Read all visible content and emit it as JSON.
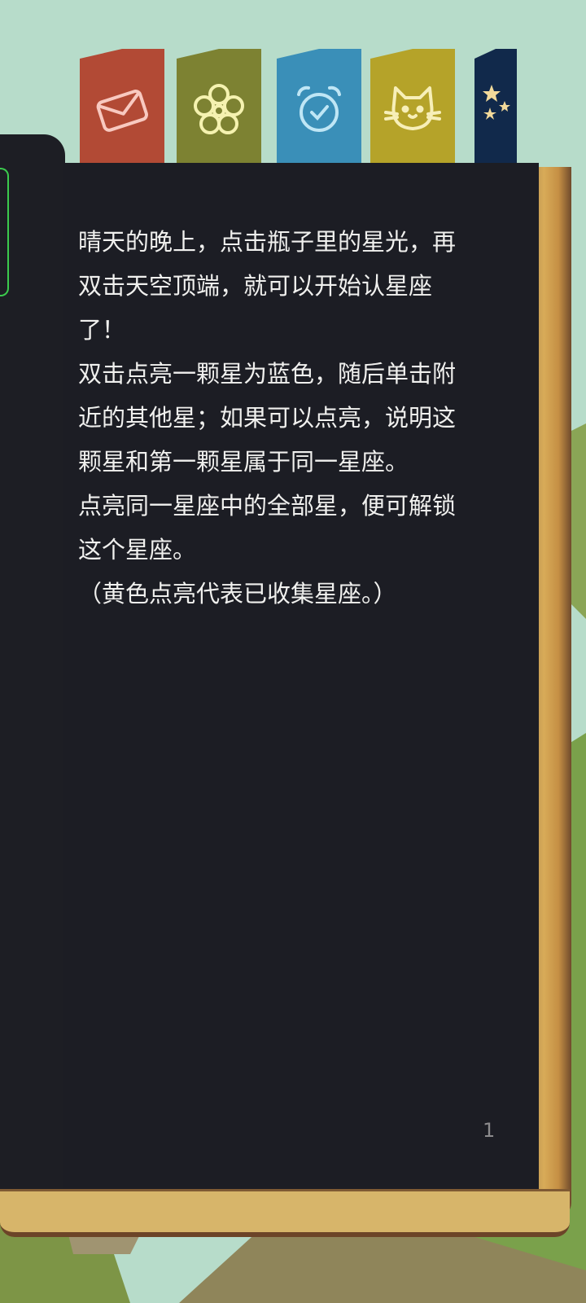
{
  "tabs": [
    {
      "name": "mail",
      "icon": "envelope-icon",
      "color": "#b24a35"
    },
    {
      "name": "flower",
      "icon": "flower-icon",
      "color": "#7d8232"
    },
    {
      "name": "clock",
      "icon": "alarm-clock-icon",
      "color": "#3a8fb8"
    },
    {
      "name": "cat",
      "icon": "cat-icon",
      "color": "#b5a329"
    },
    {
      "name": "stars",
      "icon": "stars-icon",
      "color": "#11294b"
    }
  ],
  "book": {
    "paragraphs": [
      "晴天的晚上，点击瓶子里的星光，再双击天空顶端，就可以开始认星座了！",
      "双击点亮一颗星为蓝色，随后单击附近的其他星；如果可以点亮，说明这颗星和第一颗星属于同一星座。",
      "点亮同一星座中的全部星，便可解锁这个星座。",
      "（黄色点亮代表已收集星座。）"
    ],
    "page_number": "1"
  },
  "colors": {
    "background": "#b7dcca",
    "page": "#1c1d24",
    "text": "#f0f0ee"
  }
}
